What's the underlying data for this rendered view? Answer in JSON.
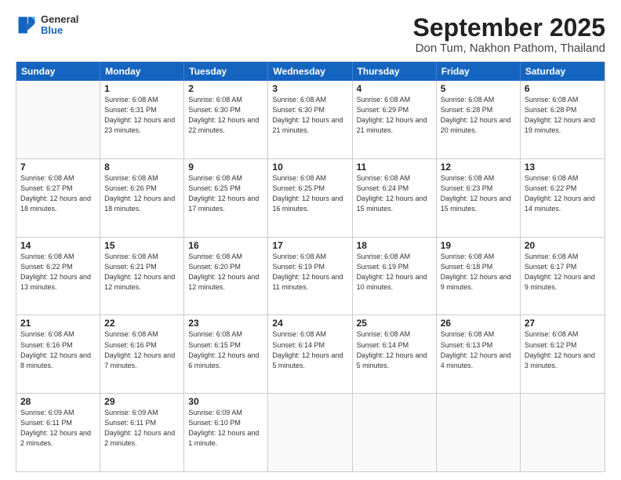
{
  "header": {
    "logo": {
      "general": "General",
      "blue": "Blue"
    },
    "title": "September 2025",
    "subtitle": "Don Tum, Nakhon Pathom, Thailand"
  },
  "calendar": {
    "days": [
      "Sunday",
      "Monday",
      "Tuesday",
      "Wednesday",
      "Thursday",
      "Friday",
      "Saturday"
    ],
    "rows": [
      [
        {
          "day": "",
          "sunrise": "",
          "sunset": "",
          "daylight": ""
        },
        {
          "day": "1",
          "sunrise": "Sunrise: 6:08 AM",
          "sunset": "Sunset: 6:31 PM",
          "daylight": "Daylight: 12 hours and 23 minutes."
        },
        {
          "day": "2",
          "sunrise": "Sunrise: 6:08 AM",
          "sunset": "Sunset: 6:30 PM",
          "daylight": "Daylight: 12 hours and 22 minutes."
        },
        {
          "day": "3",
          "sunrise": "Sunrise: 6:08 AM",
          "sunset": "Sunset: 6:30 PM",
          "daylight": "Daylight: 12 hours and 21 minutes."
        },
        {
          "day": "4",
          "sunrise": "Sunrise: 6:08 AM",
          "sunset": "Sunset: 6:29 PM",
          "daylight": "Daylight: 12 hours and 21 minutes."
        },
        {
          "day": "5",
          "sunrise": "Sunrise: 6:08 AM",
          "sunset": "Sunset: 6:28 PM",
          "daylight": "Daylight: 12 hours and 20 minutes."
        },
        {
          "day": "6",
          "sunrise": "Sunrise: 6:08 AM",
          "sunset": "Sunset: 6:28 PM",
          "daylight": "Daylight: 12 hours and 19 minutes."
        }
      ],
      [
        {
          "day": "7",
          "sunrise": "Sunrise: 6:08 AM",
          "sunset": "Sunset: 6:27 PM",
          "daylight": "Daylight: 12 hours and 18 minutes."
        },
        {
          "day": "8",
          "sunrise": "Sunrise: 6:08 AM",
          "sunset": "Sunset: 6:26 PM",
          "daylight": "Daylight: 12 hours and 18 minutes."
        },
        {
          "day": "9",
          "sunrise": "Sunrise: 6:08 AM",
          "sunset": "Sunset: 6:25 PM",
          "daylight": "Daylight: 12 hours and 17 minutes."
        },
        {
          "day": "10",
          "sunrise": "Sunrise: 6:08 AM",
          "sunset": "Sunset: 6:25 PM",
          "daylight": "Daylight: 12 hours and 16 minutes."
        },
        {
          "day": "11",
          "sunrise": "Sunrise: 6:08 AM",
          "sunset": "Sunset: 6:24 PM",
          "daylight": "Daylight: 12 hours and 15 minutes."
        },
        {
          "day": "12",
          "sunrise": "Sunrise: 6:08 AM",
          "sunset": "Sunset: 6:23 PM",
          "daylight": "Daylight: 12 hours and 15 minutes."
        },
        {
          "day": "13",
          "sunrise": "Sunrise: 6:08 AM",
          "sunset": "Sunset: 6:22 PM",
          "daylight": "Daylight: 12 hours and 14 minutes."
        }
      ],
      [
        {
          "day": "14",
          "sunrise": "Sunrise: 6:08 AM",
          "sunset": "Sunset: 6:22 PM",
          "daylight": "Daylight: 12 hours and 13 minutes."
        },
        {
          "day": "15",
          "sunrise": "Sunrise: 6:08 AM",
          "sunset": "Sunset: 6:21 PM",
          "daylight": "Daylight: 12 hours and 12 minutes."
        },
        {
          "day": "16",
          "sunrise": "Sunrise: 6:08 AM",
          "sunset": "Sunset: 6:20 PM",
          "daylight": "Daylight: 12 hours and 12 minutes."
        },
        {
          "day": "17",
          "sunrise": "Sunrise: 6:08 AM",
          "sunset": "Sunset: 6:19 PM",
          "daylight": "Daylight: 12 hours and 11 minutes."
        },
        {
          "day": "18",
          "sunrise": "Sunrise: 6:08 AM",
          "sunset": "Sunset: 6:19 PM",
          "daylight": "Daylight: 12 hours and 10 minutes."
        },
        {
          "day": "19",
          "sunrise": "Sunrise: 6:08 AM",
          "sunset": "Sunset: 6:18 PM",
          "daylight": "Daylight: 12 hours and 9 minutes."
        },
        {
          "day": "20",
          "sunrise": "Sunrise: 6:08 AM",
          "sunset": "Sunset: 6:17 PM",
          "daylight": "Daylight: 12 hours and 9 minutes."
        }
      ],
      [
        {
          "day": "21",
          "sunrise": "Sunrise: 6:08 AM",
          "sunset": "Sunset: 6:16 PM",
          "daylight": "Daylight: 12 hours and 8 minutes."
        },
        {
          "day": "22",
          "sunrise": "Sunrise: 6:08 AM",
          "sunset": "Sunset: 6:16 PM",
          "daylight": "Daylight: 12 hours and 7 minutes."
        },
        {
          "day": "23",
          "sunrise": "Sunrise: 6:08 AM",
          "sunset": "Sunset: 6:15 PM",
          "daylight": "Daylight: 12 hours and 6 minutes."
        },
        {
          "day": "24",
          "sunrise": "Sunrise: 6:08 AM",
          "sunset": "Sunset: 6:14 PM",
          "daylight": "Daylight: 12 hours and 5 minutes."
        },
        {
          "day": "25",
          "sunrise": "Sunrise: 6:08 AM",
          "sunset": "Sunset: 6:14 PM",
          "daylight": "Daylight: 12 hours and 5 minutes."
        },
        {
          "day": "26",
          "sunrise": "Sunrise: 6:08 AM",
          "sunset": "Sunset: 6:13 PM",
          "daylight": "Daylight: 12 hours and 4 minutes."
        },
        {
          "day": "27",
          "sunrise": "Sunrise: 6:08 AM",
          "sunset": "Sunset: 6:12 PM",
          "daylight": "Daylight: 12 hours and 3 minutes."
        }
      ],
      [
        {
          "day": "28",
          "sunrise": "Sunrise: 6:09 AM",
          "sunset": "Sunset: 6:11 PM",
          "daylight": "Daylight: 12 hours and 2 minutes."
        },
        {
          "day": "29",
          "sunrise": "Sunrise: 6:09 AM",
          "sunset": "Sunset: 6:11 PM",
          "daylight": "Daylight: 12 hours and 2 minutes."
        },
        {
          "day": "30",
          "sunrise": "Sunrise: 6:09 AM",
          "sunset": "Sunset: 6:10 PM",
          "daylight": "Daylight: 12 hours and 1 minute."
        },
        {
          "day": "",
          "sunrise": "",
          "sunset": "",
          "daylight": ""
        },
        {
          "day": "",
          "sunrise": "",
          "sunset": "",
          "daylight": ""
        },
        {
          "day": "",
          "sunrise": "",
          "sunset": "",
          "daylight": ""
        },
        {
          "day": "",
          "sunrise": "",
          "sunset": "",
          "daylight": ""
        }
      ]
    ]
  }
}
